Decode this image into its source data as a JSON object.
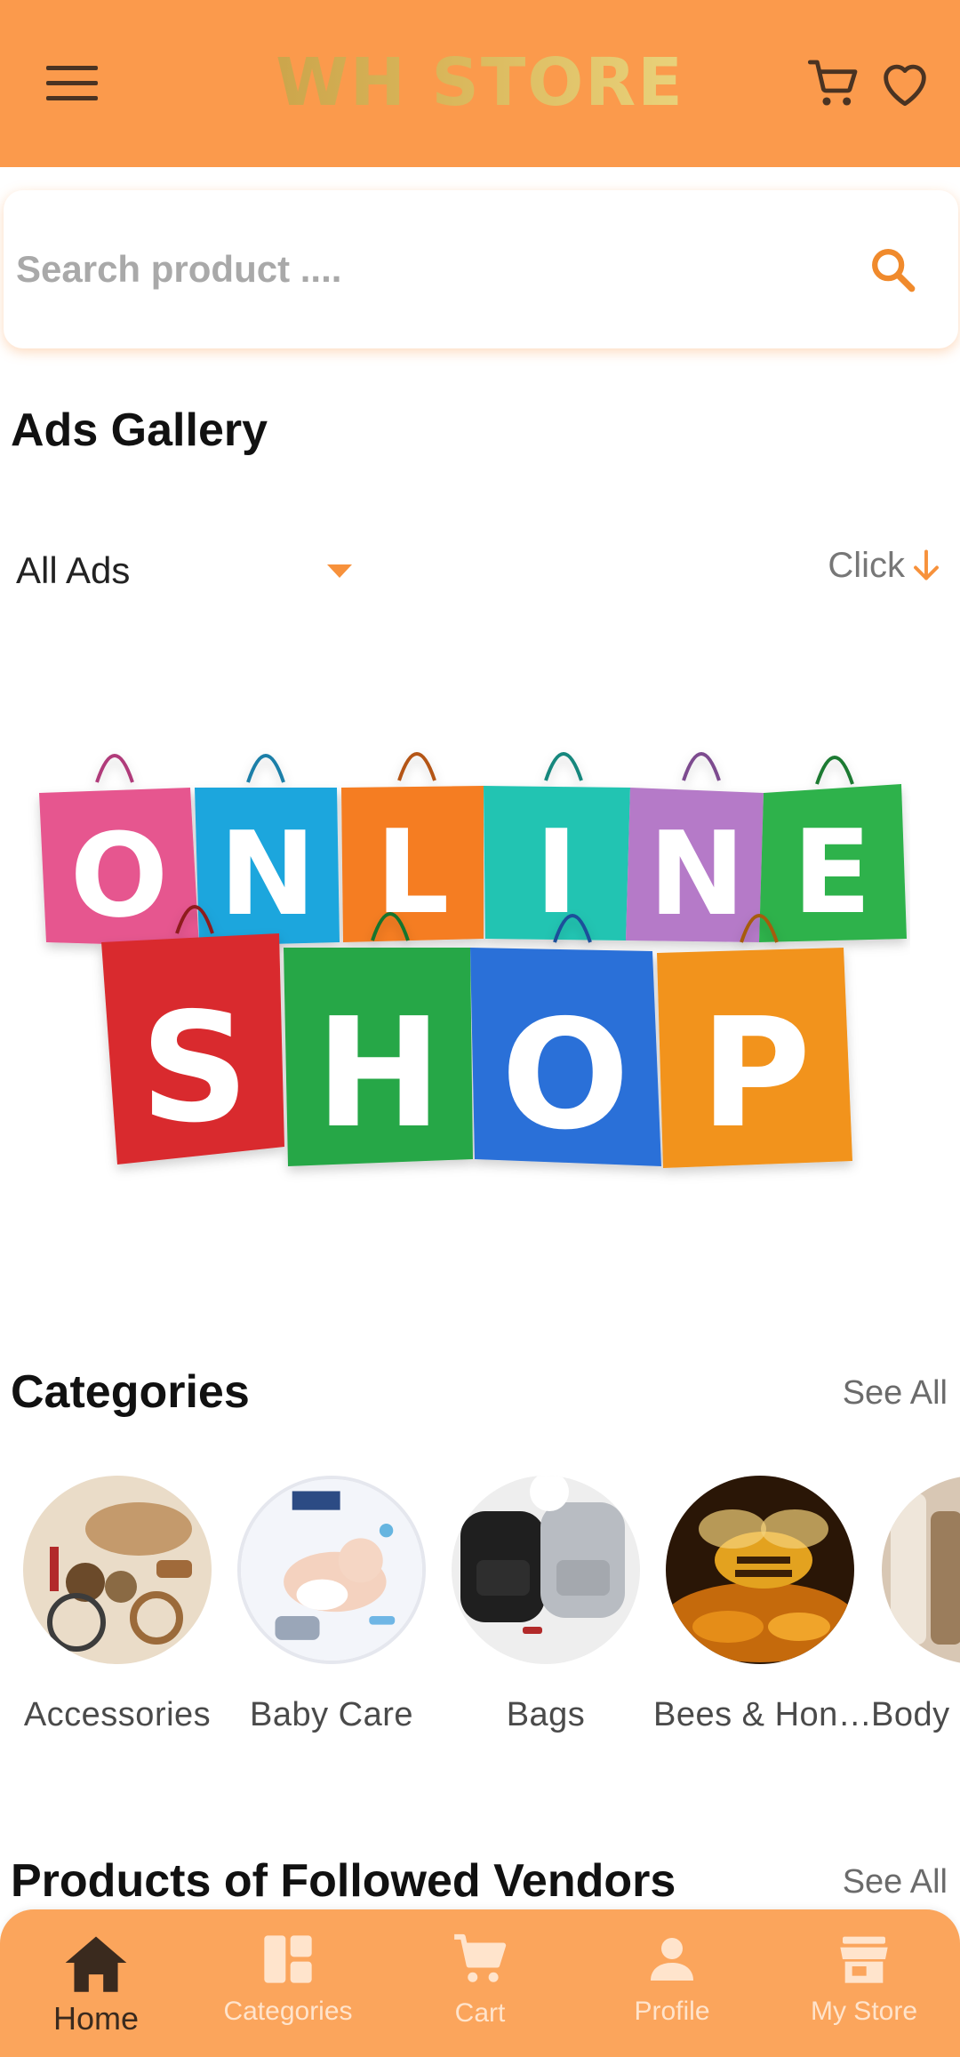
{
  "header": {
    "brand": "WH STORE",
    "menu_icon": "hamburger-menu-icon",
    "cart_icon": "cart-icon",
    "favorites_icon": "heart-outline-icon",
    "bg_color": "#fb9a4c"
  },
  "search": {
    "placeholder": "Search product ....",
    "value": "",
    "icon": "search-icon",
    "icon_color": "#f08a2c"
  },
  "ads_gallery": {
    "title": "Ads Gallery",
    "filter_selected": "All Ads",
    "click_label": "Click",
    "banner": {
      "row1": [
        "O",
        "N",
        "L",
        "I",
        "N",
        "E"
      ],
      "row2": [
        "S",
        "H",
        "O",
        "P"
      ]
    }
  },
  "categories": {
    "title": "Categories",
    "see_all": "See All",
    "items": [
      {
        "label": "Accessories"
      },
      {
        "label": "Baby Care"
      },
      {
        "label": "Bags"
      },
      {
        "label": "Bees & Hon…"
      },
      {
        "label": "Body"
      }
    ]
  },
  "followed_vendors": {
    "title": "Products of Followed Vendors",
    "see_all": "See All"
  },
  "bottom_nav": {
    "active": "Home",
    "items": [
      {
        "label": "Home",
        "icon": "home-icon"
      },
      {
        "label": "Categories",
        "icon": "dashboard-icon"
      },
      {
        "label": "Cart",
        "icon": "cart-icon"
      },
      {
        "label": "Profile",
        "icon": "person-icon"
      },
      {
        "label": "My Store",
        "icon": "store-icon"
      }
    ]
  },
  "accent_color": "#f7913b"
}
